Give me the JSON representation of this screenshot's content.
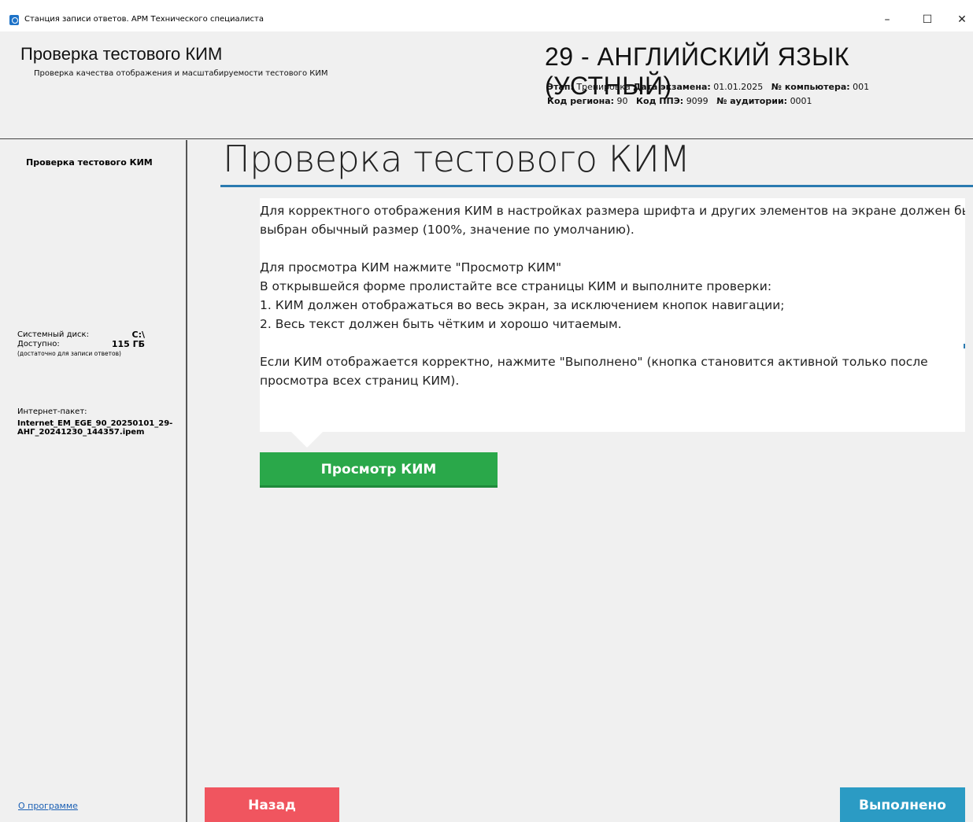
{
  "window": {
    "title": "Станция записи ответов. АРМ Технического специалиста",
    "min_glyph": "–",
    "max_glyph": "☐",
    "close_glyph": "✕"
  },
  "header": {
    "title": "Проверка тестового КИМ",
    "subtitle": "Проверка качества отображения и масштабируемости тестового КИМ",
    "exam_title": "29 - АНГЛИЙСКИЙ ЯЗЫК (УСТНЫЙ)",
    "stage_label": "Этап:",
    "stage_value": "Тренировка",
    "date_label": "Дата экзамена:",
    "date_value": "01.01.2025",
    "computer_label": "№ компьютера:",
    "computer_value": "001",
    "region_label": "Код региона:",
    "region_value": "90",
    "ppe_label": "Код ППЭ:",
    "ppe_value": "9099",
    "room_label": "№ аудитории:",
    "room_value": "0001"
  },
  "sidebar": {
    "heading": "Проверка тестового КИМ",
    "disk_label": "Системный диск:",
    "disk_value": "C:\\",
    "free_label": "Доступно:",
    "free_value": "115 ГБ",
    "free_note": "(достаточно для записи ответов)",
    "package_label": "Интернет-пакет:",
    "package_name": "Internet_EM_EGE_90_20250101_29-АНГ_20241230_144357.ipem",
    "about_link": "О программе"
  },
  "main": {
    "title": "Проверка тестового КИМ",
    "info": {
      "line1": " Для корректного отображения КИМ в настройках размера шрифта и других элементов на экране должен быть",
      "line2": "выбран обычный размер (100%, значение по умолчанию).",
      "line3": " Для просмотра КИМ нажмите \"Просмотр КИМ\"",
      "line4": " В открывшейся форме пролистайте все страницы КИМ и выполните проверки:",
      "line5": "   1. КИМ должен отображаться во весь экран, за исключением кнопок навигации;",
      "line6": "   2. Весь текст должен быть чётким и хорошо читаемым.",
      "line7": " Если КИМ отображается корректно, нажмите \"Выполнено\" (кнопка становится активной только после",
      "line8": "просмотра всех страниц КИМ)."
    },
    "view_button": "Просмотр КИМ"
  },
  "footer": {
    "back_button": "Назад",
    "done_button": "Выполнено"
  },
  "colors": {
    "accent_blue": "#2a7ab0",
    "view_green": "#2aa84a",
    "back_red": "#f0555f",
    "done_blue": "#2b9bc4"
  }
}
